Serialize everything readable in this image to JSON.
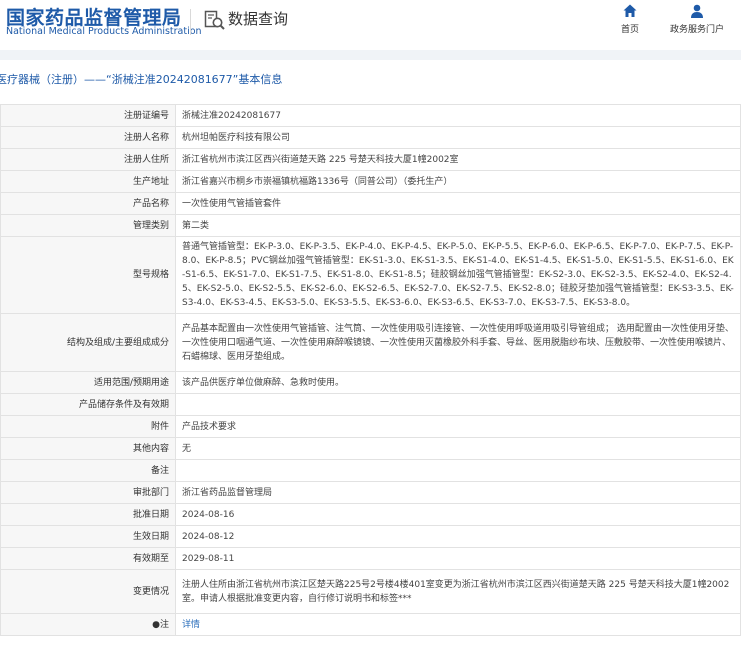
{
  "header": {
    "logo_cn": "国家药品监督管理局",
    "logo_en": "National Medical Products Administration",
    "page_title": "数据查询",
    "nav": [
      {
        "label": "首页",
        "icon": "home-icon"
      },
      {
        "label": "政务服务门户",
        "icon": "user-icon"
      }
    ]
  },
  "section_title": "医疗器械（注册）——“浙械注准20242081677”基本信息",
  "rows": [
    {
      "label": "注册证编号",
      "value": "浙械注准20242081677"
    },
    {
      "label": "注册人名称",
      "value": "杭州坦帕医疗科技有限公司"
    },
    {
      "label": "注册人住所",
      "value": "浙江省杭州市滨江区西兴街道楚天路 225 号楚天科技大厦1幢2002室"
    },
    {
      "label": "生产地址",
      "value": "浙江省嘉兴市桐乡市崇福镇杭福路1336号（同普公司）（委托生产）"
    },
    {
      "label": "产品名称",
      "value": "一次性使用气管插管套件"
    },
    {
      "label": "管理类别",
      "value": "第二类"
    },
    {
      "label": "型号规格",
      "value": "普通气管插管型：EK-P-3.0、EK-P-3.5、EK-P-4.0、EK-P-4.5、EK-P-5.0、EK-P-5.5、EK-P-6.0、EK-P-6.5、EK-P-7.0、EK-P-7.5、EK-P-8.0、EK-P-8.5；PVC钢丝加强气管插管型：EK-S1-3.0、EK-S1-3.5、EK-S1-4.0、EK-S1-4.5、EK-S1-5.0、EK-S1-5.5、EK-S1-6.0、EK-S1-6.5、EK-S1-7.0、EK-S1-7.5、EK-S1-8.0、EK-S1-8.5；硅胶钢丝加强气管插管型：EK-S2-3.0、EK-S2-3.5、EK-S2-4.0、EK-S2-4.5、EK-S2-5.0、EK-S2-5.5、EK-S2-6.0、EK-S2-6.5、EK-S2-7.0、EK-S2-7.5、EK-S2-8.0；硅胶牙垫加强气管插管型：EK-S3-3.5、EK-S3-4.0、EK-S3-4.5、EK-S3-5.0、EK-S3-5.5、EK-S3-6.0、EK-S3-6.5、EK-S3-7.0、EK-S3-7.5、EK-S3-8.0。"
    },
    {
      "label": "结构及组成/主要组成成分",
      "value": "产品基本配置由一次性使用气管插管、注气筒、一次性使用吸引连接管、一次性使用呼吸道用吸引导管组成； 选用配置由一次性使用牙垫、一次性使用口咽通气道、一次性使用麻醉喉镜镜、一次性使用灭菌橡胶外科手套、导丝、医用脱脂纱布块、压敷胶带、一次性使用喉镜片、石蜡棉球、医用牙垫组成。"
    },
    {
      "label": "适用范围/预期用途",
      "value": "该产品供医疗单位做麻醉、急救时使用。"
    },
    {
      "label": "产品储存条件及有效期",
      "value": ""
    },
    {
      "label": "附件",
      "value": "产品技术要求"
    },
    {
      "label": "其他内容",
      "value": "无"
    },
    {
      "label": "备注",
      "value": ""
    },
    {
      "label": "审批部门",
      "value": "浙江省药品监督管理局"
    },
    {
      "label": "批准日期",
      "value": "2024-08-16"
    },
    {
      "label": "生效日期",
      "value": "2024-08-12"
    },
    {
      "label": "有效期至",
      "value": "2029-08-11"
    },
    {
      "label": "变更情况",
      "value": "注册人住所由浙江省杭州市滨江区楚天路225号2号楼4楼401室变更为浙江省杭州市滨江区西兴街道楚天路 225 号楚天科技大厦1幢2002室。申请人根据批准变更内容，自行修订说明书和标签***"
    },
    {
      "label": "●注",
      "value": "详情"
    }
  ],
  "colors": {
    "brand": "#1e5aa8",
    "link": "#2a6ebb",
    "label_bg": "#f7f7f7",
    "border": "#e2e2e2"
  }
}
